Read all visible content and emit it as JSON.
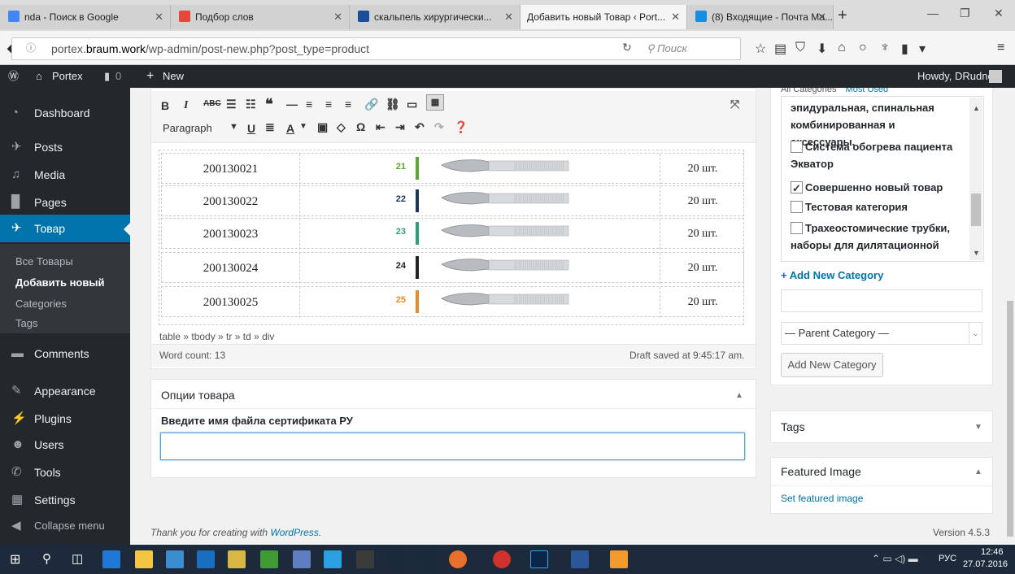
{
  "browser": {
    "tabs": [
      {
        "label": "nda - Поиск в Google",
        "color": "#4285f4"
      },
      {
        "label": "Подбор слов",
        "color": "#e8453c"
      },
      {
        "label": "скальпель хирургически...",
        "color": "#1a4e9a"
      },
      {
        "label": "Добавить новый Товар ‹ Port...",
        "color": "#ffffff"
      },
      {
        "label": "(8) Входящие - Почта Ма...",
        "color": "#168de2"
      }
    ],
    "url_prefix": "portex.",
    "url_host": "braum.work",
    "url_path": "/wp-admin/post-new.php?post_type=product",
    "search_placeholder": "Поиск"
  },
  "adminbar": {
    "site": "Portex",
    "comments": "0",
    "new": "New",
    "howdy": "Howdy, DRudnev"
  },
  "sidebar": {
    "items": [
      {
        "label": "Dashboard",
        "icon": "dashboard-icon"
      },
      {
        "label": "Posts",
        "icon": "pin-icon"
      },
      {
        "label": "Media",
        "icon": "media-icon"
      },
      {
        "label": "Pages",
        "icon": "pages-icon"
      },
      {
        "label": "Товар",
        "icon": "pin-icon"
      },
      {
        "label": "Comments",
        "icon": "comment-icon"
      },
      {
        "label": "Appearance",
        "icon": "brush-icon"
      },
      {
        "label": "Plugins",
        "icon": "plug-icon"
      },
      {
        "label": "Users",
        "icon": "users-icon"
      },
      {
        "label": "Tools",
        "icon": "wrench-icon"
      },
      {
        "label": "Settings",
        "icon": "settings-icon"
      },
      {
        "label": "Collapse menu",
        "icon": "collapse-icon"
      }
    ],
    "submenu": [
      "Все Товары",
      "Добавить новый",
      "Categories",
      "Tags"
    ]
  },
  "editor": {
    "format": "Paragraph",
    "rows": [
      {
        "code": "200130021",
        "num": "21",
        "color": "#5aa832",
        "qty": "20 шт."
      },
      {
        "code": "200130022",
        "num": "22",
        "color": "#1d3557",
        "qty": "20 шт."
      },
      {
        "code": "200130023",
        "num": "23",
        "color": "#2e9e7a",
        "qty": "20 шт."
      },
      {
        "code": "200130024",
        "num": "24",
        "color": "#222222",
        "qty": "20 шт."
      },
      {
        "code": "200130025",
        "num": "25",
        "color": "#e88a2a",
        "qty": "20 шт."
      }
    ],
    "path": "table » tbody » tr » td » div",
    "word_count": "Word count: 13",
    "draft_saved": "Draft saved at 9:45:17 am."
  },
  "options_box": {
    "title": "Опции товара",
    "field_label": "Введите имя файла сертификата РУ",
    "field_value": ""
  },
  "categories": {
    "tab_all": "All Categories",
    "tab_used": "Most Used",
    "items": [
      {
        "label": "эпидуральная, спинальная комбинированная и аксессуары.",
        "checkbox": false
      },
      {
        "label": "Система обогрева пациента Экватор",
        "checkbox": true,
        "checked": false
      },
      {
        "label": "Совершенно новый товар",
        "checkbox": true,
        "checked": true
      },
      {
        "label": "Тестовая категория",
        "checkbox": true,
        "checked": false
      },
      {
        "label": "Трахеостомические трубки, наборы для дилятационной",
        "checkbox": true,
        "checked": false
      }
    ],
    "add_link": "+ Add New Category",
    "parent_select": "— Parent Category —",
    "add_button": "Add New Category"
  },
  "tags_box": {
    "title": "Tags"
  },
  "featured_box": {
    "title": "Featured Image",
    "link": "Set featured image"
  },
  "footer": {
    "text": "Thank you for creating with ",
    "link": "WordPress",
    "version": "Version 4.5.3"
  },
  "taskbar": {
    "lang": "РУС",
    "time": "12:46",
    "date": "27.07.2016"
  }
}
